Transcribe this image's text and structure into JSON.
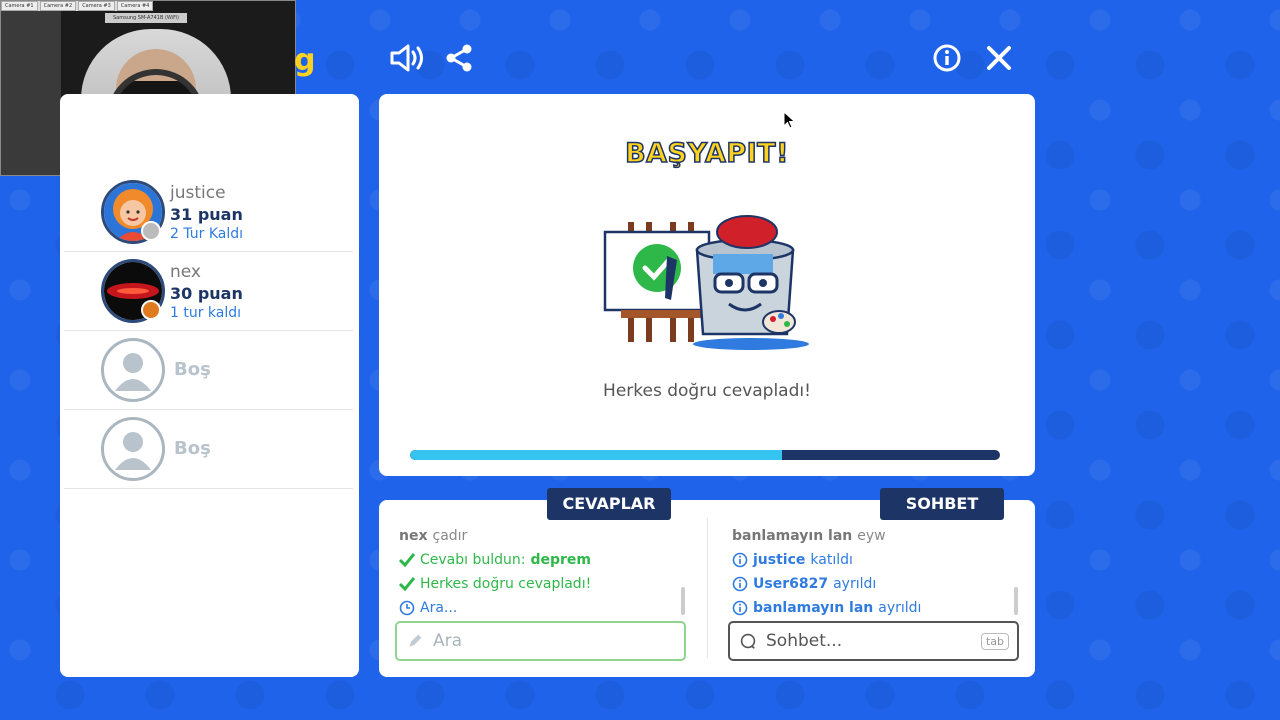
{
  "webcam": {
    "tabs": [
      "Camera #1",
      "Camera #2",
      "Camera #3",
      "Camera #4"
    ],
    "device_label": "Samsung SM-A741B (WiFi)"
  },
  "players": [
    {
      "name": "justice",
      "score": "31 puan",
      "turns": "2 Tur Kaldı",
      "status_color": "#bbbbbb"
    },
    {
      "name": "nex",
      "score": "30 puan",
      "turns": "1 tur kaldı",
      "status_color": "#e07a1f"
    },
    {
      "name": "Boş",
      "empty": true
    },
    {
      "name": "Boş",
      "empty": true
    }
  ],
  "result": {
    "title": "BAŞYAPIT!",
    "message": "Herkes doğru cevapladı!",
    "progress": 0.63
  },
  "answers": {
    "tab_label": "CEVAPLAR",
    "messages": {
      "m1_nick": "nex",
      "m1_text": "çadır",
      "m2_text": "Cevabı buldun:",
      "m2_word": "deprem",
      "m3_text": "Herkes doğru cevapladı!",
      "m4_text": "Ara..."
    },
    "input_placeholder": "Ara"
  },
  "chat": {
    "tab_label": "SOHBET",
    "messages": {
      "m1_nick": "banlamayın lan",
      "m1_text": "eyw",
      "m2_user": "justice",
      "m2_text": "katıldı",
      "m3_user": "User6827",
      "m3_text": "ayrıldı",
      "m4_user": "banlamayın lan",
      "m4_text": "ayrıldı"
    },
    "input_placeholder": "Sohbet...",
    "shortcut": "tab"
  },
  "colors": {
    "background": "#1f63ea",
    "navy": "#1d3566",
    "accent_yellow": "#ffd21f",
    "progress": "#35c4ef",
    "success": "#2fb84a",
    "info": "#2f7be0"
  }
}
